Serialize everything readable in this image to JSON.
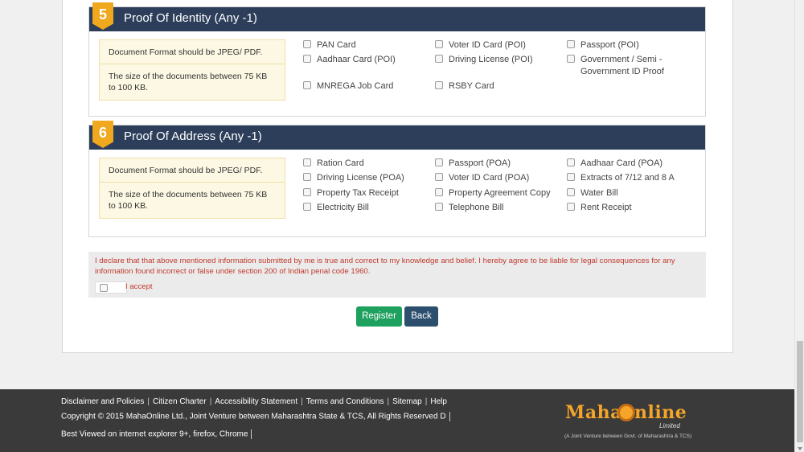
{
  "poi": {
    "number": "5",
    "title": "Proof Of Identity (Any -1)",
    "note_format": "Document Format should be JPEG/ PDF.",
    "note_size": "The size of the documents between 75 KB to 100 KB.",
    "options": [
      "PAN Card",
      "Voter ID Card (POI)",
      "Passport (POI)",
      "Aadhaar Card (POI)",
      "Driving License (POI)",
      "Government / Semi - Government ID Proof",
      "MNREGA Job Card",
      "RSBY Card"
    ]
  },
  "poa": {
    "number": "6",
    "title": "Proof Of Address (Any -1)",
    "note_format": "Document Format should be JPEG/ PDF.",
    "note_size": "The size of the documents between 75 KB to 100 KB.",
    "options": [
      "Ration Card",
      "Passport (POA)",
      "Aadhaar Card (POA)",
      "Driving License (POA)",
      "Voter ID Card (POA)",
      "Extracts of 7/12 and 8 A",
      "Property Tax Receipt",
      "Property Agreement Copy",
      "Water Bill",
      "Electricity Bill",
      "Telephone Bill",
      "Rent Receipt"
    ]
  },
  "declaration": {
    "text": "I declare that that above mentioned information submitted by me is true and correct to my knowledge and belief. I hereby agree to be liable for legal consequences for any information found incorrect or false under section 200 of Indian penal code 1960.",
    "accept_label": "I accept"
  },
  "buttons": {
    "register": "Register",
    "back": "Back"
  },
  "footer": {
    "links": [
      "Disclaimer and Policies",
      "Citizen Charter",
      "Accessibility Statement",
      "Terms and Conditions",
      "Sitemap",
      "Help"
    ],
    "copyright": "Copyright © 2015 MahaOnline Ltd., Joint Venture between Maharashtra State & TCS, All Rights Reserved D",
    "best_viewed": "Best Viewed on internet explorer 9+, firefox, Chrome",
    "logo_text": "Mahaonline",
    "logo_limited": "Limited",
    "logo_tagline": "(A Joint Venture between Govt. of Maharashtra & TCS)"
  },
  "colors": {
    "header": "#2c3e5a",
    "badge": "#f0a81e",
    "register": "#1ea05e",
    "back": "#2c4f6e",
    "declaration_text": "#c0392b",
    "footer": "#3a3a3a"
  }
}
